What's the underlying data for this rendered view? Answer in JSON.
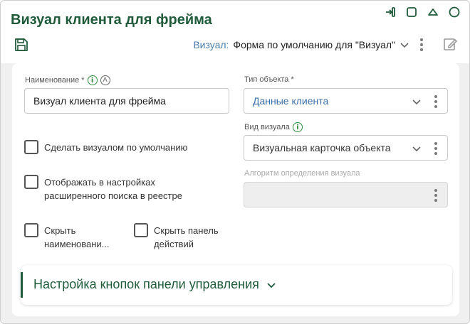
{
  "window": {
    "title": "Визуал клиента для фрейма"
  },
  "toolbar": {
    "visual_label": "Визуал:",
    "visual_value": "Форма по умолчанию для \"Визуал\""
  },
  "form": {
    "name": {
      "label": "Наименование *",
      "value": "Визуал клиента для фрейма"
    },
    "object_type": {
      "label": "Тип объекта *",
      "value": "Данные клиента"
    },
    "visual_kind": {
      "label": "Вид визуала",
      "value": "Визуальная карточка объекта"
    },
    "visual_algorithm": {
      "label": "Алгоритм определения визуала",
      "value": ""
    },
    "checkboxes": {
      "make_default": "Сделать визуалом по умолчанию",
      "show_in_search_line1": "Отображать в настройках",
      "show_in_search_line2": "расширенного поиска в реестре",
      "hide_name_line1": "Скрыть",
      "hide_name_line2": "наименовани...",
      "hide_panel_line1": "Скрыть панель",
      "hide_panel_line2": "действий"
    }
  },
  "section": {
    "title": "Настройка кнопок панели управления"
  },
  "colors": {
    "brand_green": "#1f5a3a",
    "link_blue": "#3a6ea5",
    "info_green": "#2e8b3c"
  },
  "icons": {
    "info_icon_glyph": "i",
    "auto_icon_glyph": "A"
  }
}
